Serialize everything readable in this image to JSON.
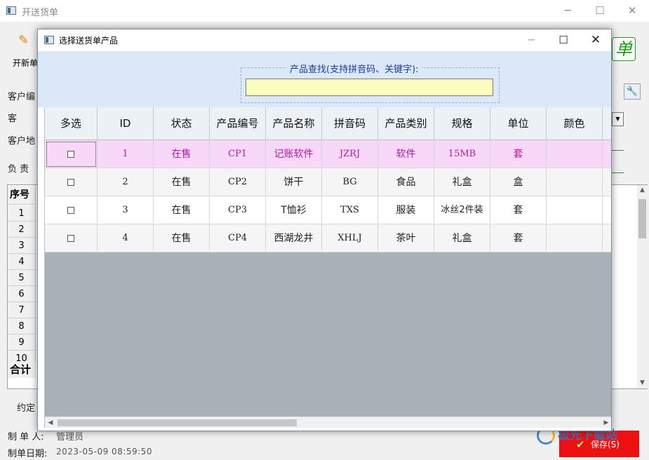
{
  "main_window": {
    "title": "开送货单",
    "window_controls": {
      "minimize": "─",
      "maximize": "☐",
      "close": "✕"
    },
    "toolbar": {
      "new_order_label": "开新单",
      "new_order_icon": "pencil-icon"
    },
    "logo_text": "单",
    "form_labels": {
      "customer_code": "客户编",
      "customer": "客",
      "customer_address": "客户地",
      "person_in_charge": "负  责"
    },
    "grid": {
      "header": "序号",
      "row_numbers": [
        "1",
        "2",
        "3",
        "4",
        "5",
        "6",
        "7",
        "8",
        "9",
        "10"
      ],
      "total_label": "合计"
    },
    "footer": {
      "agreed_label": "约定",
      "maker_label": "制 单 人:",
      "maker_value": "管理员",
      "date_label": "制单日期:",
      "date_value": "2023-05-09 08:59:50"
    },
    "save_button": {
      "label": "保存(S)",
      "icon": "check-icon"
    },
    "watermark": "极光下载站"
  },
  "dialog": {
    "title": "选择送货单产品",
    "window_controls": {
      "minimize": "─",
      "maximize": "☐",
      "close": "✕"
    },
    "search": {
      "label": "产品查找(支持拼音码、关键字):",
      "value": ""
    },
    "columns": [
      "多选",
      "ID",
      "状态",
      "产品编号",
      "产品名称",
      "拼音码",
      "产品类别",
      "规格",
      "单位",
      "颜色"
    ],
    "rows": [
      {
        "checked": false,
        "id": "1",
        "status": "在售",
        "code": "CP1",
        "name": "记账软件",
        "pinyin": "JZRJ",
        "category": "软件",
        "spec": "15MB",
        "unit": "套",
        "color": ""
      },
      {
        "checked": false,
        "id": "2",
        "status": "在售",
        "code": "CP2",
        "name": "饼干",
        "pinyin": "BG",
        "category": "食品",
        "spec": "礼盒",
        "unit": "盒",
        "color": ""
      },
      {
        "checked": false,
        "id": "3",
        "status": "在售",
        "code": "CP3",
        "name": "T恤衫",
        "pinyin": "TXS",
        "category": "服装",
        "spec": "冰丝2件装",
        "unit": "套",
        "color": ""
      },
      {
        "checked": false,
        "id": "4",
        "status": "在售",
        "code": "CP4",
        "name": "西湖龙井",
        "pinyin": "XHLJ",
        "category": "茶叶",
        "spec": "礼盒",
        "unit": "套",
        "color": ""
      }
    ],
    "selected_row_index": 0,
    "colors": {
      "selected_bg": "#f8d8f8",
      "selected_text": "#b41aa8",
      "search_bg": "#dbe8f8",
      "input_bg": "#fcfcbe",
      "empty_grid_bg": "#a9b1b8"
    }
  }
}
